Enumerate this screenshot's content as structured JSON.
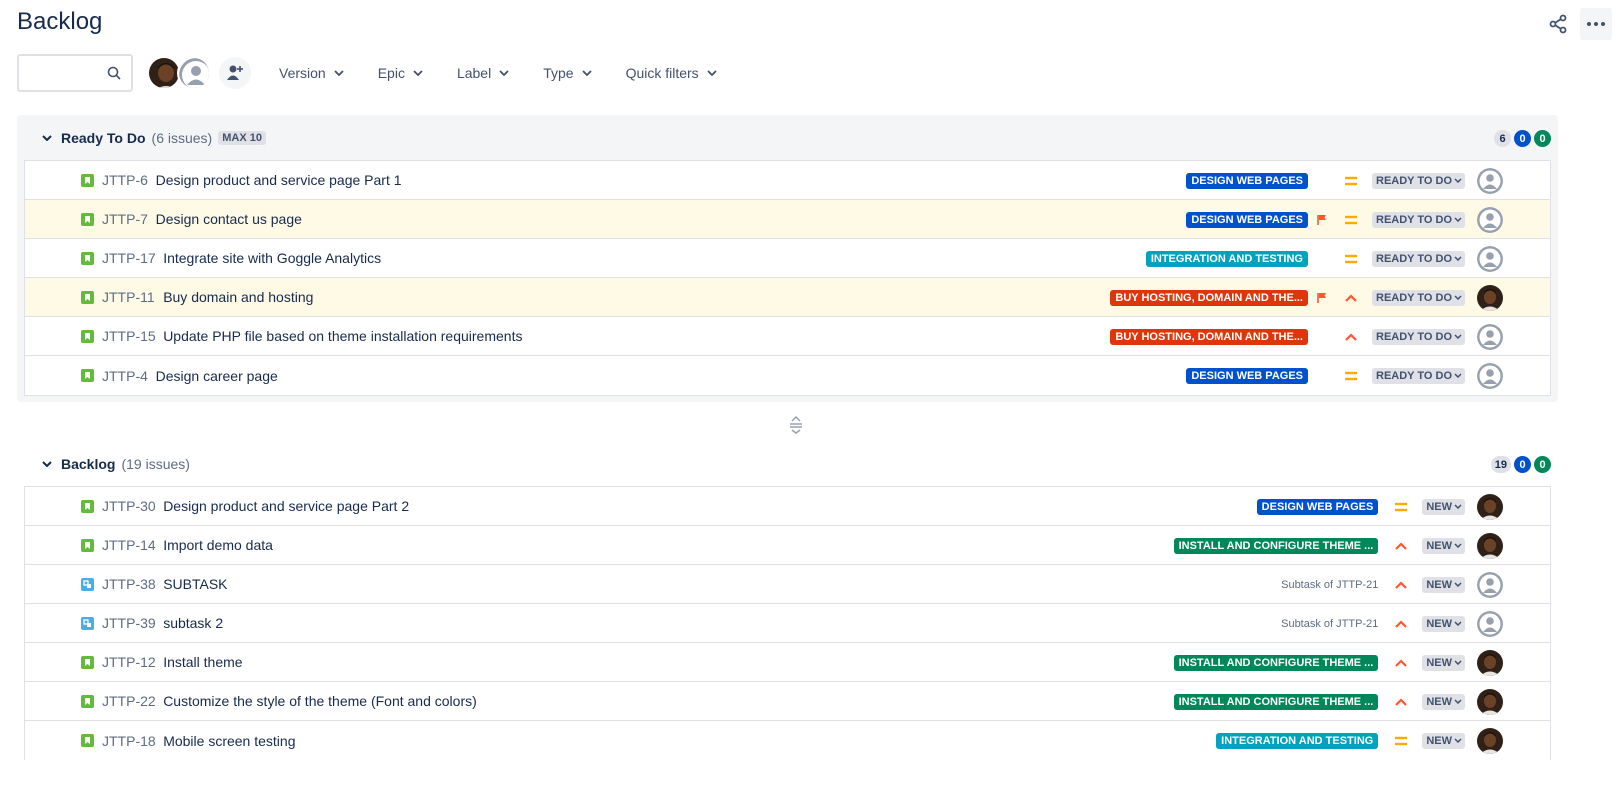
{
  "page": {
    "title": "Backlog"
  },
  "toolbar": {
    "search_placeholder": "",
    "filters": [
      {
        "label": "Version"
      },
      {
        "label": "Epic"
      },
      {
        "label": "Label"
      },
      {
        "label": "Type"
      },
      {
        "label": "Quick filters"
      }
    ]
  },
  "sprint": {
    "name": "Ready To Do",
    "issue_count": "(6 issues)",
    "max": "MAX 10",
    "counts": [
      "6",
      "0",
      "0"
    ],
    "issues": [
      {
        "key": "JTTP-6",
        "summary": "Design product and service page Part 1",
        "epic": "DESIGN WEB PAGES",
        "epic_color": "#0052cc",
        "flagged": false,
        "priority": "medium",
        "status": "READY TO DO",
        "assignee": "unassigned",
        "type": "story"
      },
      {
        "key": "JTTP-7",
        "summary": "Design contact us page",
        "epic": "DESIGN WEB PAGES",
        "epic_color": "#0052cc",
        "flagged": true,
        "priority": "medium",
        "status": "READY TO DO",
        "assignee": "unassigned",
        "type": "story"
      },
      {
        "key": "JTTP-17",
        "summary": "Integrate site with Goggle Analytics",
        "epic": "INTEGRATION AND TESTING",
        "epic_color": "#00a3bf",
        "flagged": false,
        "priority": "medium",
        "status": "READY TO DO",
        "assignee": "unassigned",
        "type": "story"
      },
      {
        "key": "JTTP-11",
        "summary": "Buy domain and hosting",
        "epic": "BUY HOSTING, DOMAIN AND THE...",
        "epic_color": "#de350b",
        "flagged": true,
        "priority": "high",
        "status": "READY TO DO",
        "assignee": "user",
        "type": "story"
      },
      {
        "key": "JTTP-15",
        "summary": "Update PHP file based on theme installation requirements",
        "epic": "BUY HOSTING, DOMAIN AND THE...",
        "epic_color": "#de350b",
        "flagged": false,
        "priority": "high",
        "status": "READY TO DO",
        "assignee": "unassigned",
        "type": "story"
      },
      {
        "key": "JTTP-4",
        "summary": "Design career page",
        "epic": "DESIGN WEB PAGES",
        "epic_color": "#0052cc",
        "flagged": false,
        "priority": "medium",
        "status": "READY TO DO",
        "assignee": "unassigned",
        "type": "story"
      }
    ]
  },
  "backlog": {
    "name": "Backlog",
    "issue_count": "(19 issues)",
    "counts": [
      "19",
      "0",
      "0"
    ],
    "issues": [
      {
        "key": "JTTP-30",
        "summary": "Design product and service page Part 2",
        "epic": "DESIGN WEB PAGES",
        "epic_color": "#0052cc",
        "priority": "medium",
        "status": "NEW",
        "assignee": "user",
        "type": "story"
      },
      {
        "key": "JTTP-14",
        "summary": "Import demo data",
        "epic": "INSTALL AND CONFIGURE THEME ...",
        "epic_color": "#00875a",
        "priority": "high",
        "status": "NEW",
        "assignee": "user",
        "type": "story"
      },
      {
        "key": "JTTP-38",
        "summary": "SUBTASK",
        "parent": "Subtask of JTTP-21",
        "priority": "high",
        "status": "NEW",
        "assignee": "unassigned",
        "type": "subtask"
      },
      {
        "key": "JTTP-39",
        "summary": "subtask 2",
        "parent": "Subtask of JTTP-21",
        "priority": "high",
        "status": "NEW",
        "assignee": "unassigned",
        "type": "subtask"
      },
      {
        "key": "JTTP-12",
        "summary": "Install theme",
        "epic": "INSTALL AND CONFIGURE THEME ...",
        "epic_color": "#00875a",
        "priority": "high",
        "status": "NEW",
        "assignee": "user",
        "type": "story"
      },
      {
        "key": "JTTP-22",
        "summary": "Customize the style of the theme (Font and colors)",
        "epic": "INSTALL AND CONFIGURE THEME ...",
        "epic_color": "#00875a",
        "priority": "high",
        "status": "NEW",
        "assignee": "user",
        "type": "story"
      },
      {
        "key": "JTTP-18",
        "summary": "Mobile screen testing",
        "epic": "INTEGRATION AND TESTING",
        "epic_color": "#00a3bf",
        "priority": "medium",
        "status": "NEW",
        "assignee": "user",
        "type": "story"
      }
    ]
  }
}
